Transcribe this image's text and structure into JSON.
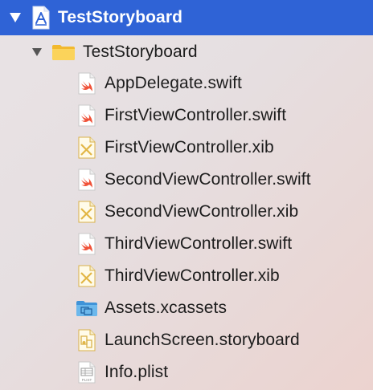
{
  "project": {
    "name": "TestStoryboard",
    "icon": "xcode-project-icon"
  },
  "group": {
    "name": "TestStoryboard",
    "icon": "folder-icon"
  },
  "files": [
    {
      "name": "AppDelegate.swift",
      "icon": "swift-file-icon"
    },
    {
      "name": "FirstViewController.swift",
      "icon": "swift-file-icon"
    },
    {
      "name": "FirstViewController.xib",
      "icon": "xib-file-icon"
    },
    {
      "name": "SecondViewController.swift",
      "icon": "swift-file-icon"
    },
    {
      "name": "SecondViewController.xib",
      "icon": "xib-file-icon"
    },
    {
      "name": "ThirdViewController.swift",
      "icon": "swift-file-icon"
    },
    {
      "name": "ThirdViewController.xib",
      "icon": "xib-file-icon"
    },
    {
      "name": "Assets.xcassets",
      "icon": "asset-catalog-icon"
    },
    {
      "name": "LaunchScreen.storyboard",
      "icon": "storyboard-file-icon"
    },
    {
      "name": "Info.plist",
      "icon": "plist-file-icon"
    }
  ],
  "plist_badge": "PLIST",
  "colors": {
    "selection": "#2f63d6",
    "swift": "#f05138",
    "xib_border": "#e2b646",
    "folder": "#f5c83e",
    "assets": "#5aa9e6"
  }
}
